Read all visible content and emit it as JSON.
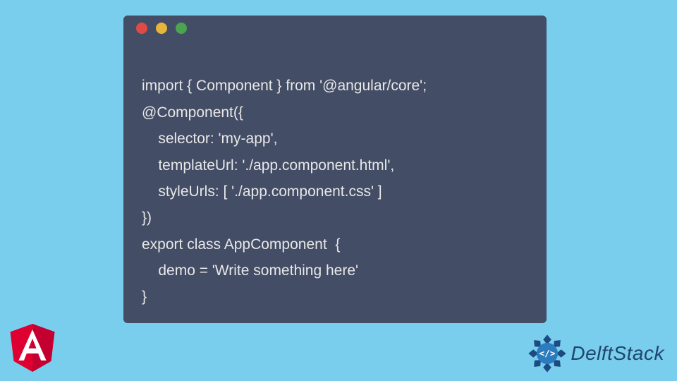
{
  "code": {
    "lines": [
      "import { Component } from '@angular/core';",
      "@Component({",
      "    selector: 'my-app',",
      "    templateUrl: './app.component.html',",
      "    styleUrls: [ './app.component.css' ]",
      "})",
      "export class AppComponent  {",
      "    demo = 'Write something here'",
      "}"
    ]
  },
  "branding": {
    "delft_label": "DelftStack"
  }
}
